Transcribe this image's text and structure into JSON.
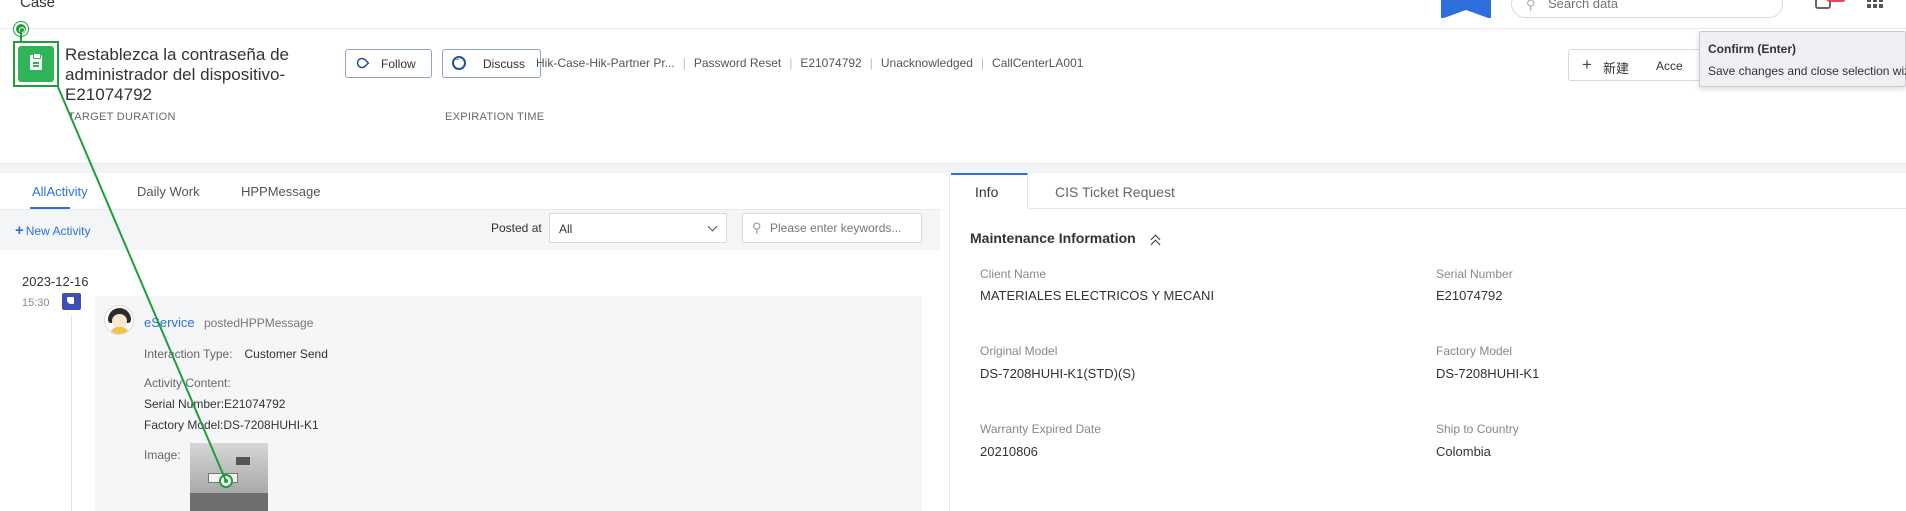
{
  "topbar": {
    "case_label": "Case",
    "search_placeholder": "Search data"
  },
  "header": {
    "title": "Restablezca la contraseña de administrador del dispositivo-E21074792",
    "follow_label": "Follow",
    "discuss_label": "Discuss",
    "breadcrumbs": [
      "Hik-Case-Hik-Partner Pr...",
      "Password Reset",
      "E21074792",
      "Unacknowledged",
      "CallCenterLA001"
    ],
    "target_duration_label": "TARGET DURATION",
    "expiration_time_label": "EXPIRATION TIME",
    "new_button_label": "新建",
    "accept_button_label": "Acce"
  },
  "tooltip": {
    "title": "Confirm (Enter)",
    "body": "Save changes and close selection wizard"
  },
  "left_panel": {
    "tabs": [
      {
        "label": "AllActivity"
      },
      {
        "label": "Daily Work"
      },
      {
        "label": "HPPMessage"
      }
    ],
    "new_activity_label": "New Activity",
    "posted_at_label": "Posted at",
    "posted_at_value": "All",
    "keyword_placeholder": "Please enter keywords...",
    "activity": {
      "date": "2023-12-16",
      "time": "15:30",
      "poster": "eService",
      "action": "postedHPPMessage",
      "interaction_type_label": "Interaction Type:",
      "interaction_type_value": "Customer Send",
      "content_label": "Activity Content:",
      "serial_line": "Serial Number:E21074792",
      "model_line": "Factory Model:DS-7208HUHI-K1",
      "image_label": "Image:"
    }
  },
  "right_panel": {
    "tabs": [
      {
        "label": "Info"
      },
      {
        "label": "CIS Ticket Request"
      }
    ],
    "section_title": "Maintenance Information",
    "fields": {
      "client_name": {
        "label": "Client Name",
        "value": "MATERIALES ELECTRICOS Y MECANI"
      },
      "serial_number": {
        "label": "Serial Number",
        "value": "E21074792"
      },
      "original_model": {
        "label": "Original Model",
        "value": "DS-7208HUHI-K1(STD)(S)"
      },
      "factory_model": {
        "label": "Factory Model",
        "value": "DS-7208HUHI-K1"
      },
      "warranty_expired": {
        "label": "Warranty Expired Date",
        "value": "20210806"
      },
      "ship_to_country": {
        "label": "Ship to Country",
        "value": "Colombia"
      }
    }
  },
  "colors": {
    "accent_blue": "#2f6fdd",
    "case_green": "#2fb457",
    "overlay_green": "#1e9e3b"
  },
  "icons": [
    "search-icon",
    "bell-icon",
    "app-grid-icon",
    "clipboard-icon",
    "follow-icon",
    "discuss-icon",
    "plus-icon",
    "chevron-down-icon",
    "tag-icon",
    "collapse-up-icon"
  ]
}
